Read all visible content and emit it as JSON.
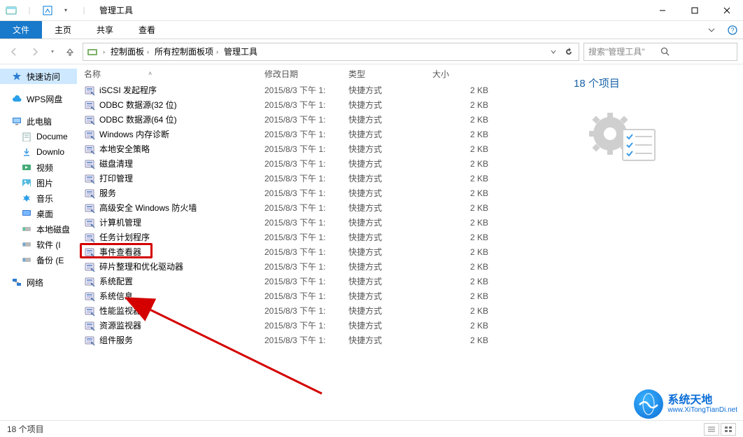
{
  "window": {
    "title": "管理工具",
    "min": "—",
    "max": "□",
    "close": "✕"
  },
  "ribbon": {
    "file": "文件",
    "tabs": [
      "主页",
      "共享",
      "查看"
    ]
  },
  "address": {
    "crumbs": [
      "控制面板",
      "所有控制面板项",
      "管理工具"
    ]
  },
  "search": {
    "placeholder": "搜索\"管理工具\""
  },
  "nav": {
    "quick": "快速访问",
    "wps": "WPS网盘",
    "thispc": "此电脑",
    "thispc_items": [
      "Docume",
      "Downlo",
      "视频",
      "图片",
      "音乐",
      "桌面",
      "本地磁盘",
      "软件 (I",
      "备份 (E"
    ],
    "network": "网络"
  },
  "columns": {
    "name": "名称",
    "date": "修改日期",
    "type": "类型",
    "size": "大小"
  },
  "rows": [
    {
      "name": "iSCSI 发起程序",
      "date": "2015/8/3 下午 1:",
      "type": "快捷方式",
      "size": "2 KB"
    },
    {
      "name": "ODBC 数据源(32 位)",
      "date": "2015/8/3 下午 1:",
      "type": "快捷方式",
      "size": "2 KB"
    },
    {
      "name": "ODBC 数据源(64 位)",
      "date": "2015/8/3 下午 1:",
      "type": "快捷方式",
      "size": "2 KB"
    },
    {
      "name": "Windows 内存诊断",
      "date": "2015/8/3 下午 1:",
      "type": "快捷方式",
      "size": "2 KB"
    },
    {
      "name": "本地安全策略",
      "date": "2015/8/3 下午 1:",
      "type": "快捷方式",
      "size": "2 KB"
    },
    {
      "name": "磁盘清理",
      "date": "2015/8/3 下午 1:",
      "type": "快捷方式",
      "size": "2 KB"
    },
    {
      "name": "打印管理",
      "date": "2015/8/3 下午 1:",
      "type": "快捷方式",
      "size": "2 KB"
    },
    {
      "name": "服务",
      "date": "2015/8/3 下午 1:",
      "type": "快捷方式",
      "size": "2 KB"
    },
    {
      "name": "高级安全 Windows 防火墙",
      "date": "2015/8/3 下午 1:",
      "type": "快捷方式",
      "size": "2 KB"
    },
    {
      "name": "计算机管理",
      "date": "2015/8/3 下午 1:",
      "type": "快捷方式",
      "size": "2 KB"
    },
    {
      "name": "任务计划程序",
      "date": "2015/8/3 下午 1:",
      "type": "快捷方式",
      "size": "2 KB"
    },
    {
      "name": "事件查看器",
      "date": "2015/8/3 下午 1:",
      "type": "快捷方式",
      "size": "2 KB",
      "hl": true
    },
    {
      "name": "碎片整理和优化驱动器",
      "date": "2015/8/3 下午 1:",
      "type": "快捷方式",
      "size": "2 KB"
    },
    {
      "name": "系统配置",
      "date": "2015/8/3 下午 1:",
      "type": "快捷方式",
      "size": "2 KB"
    },
    {
      "name": "系统信息",
      "date": "2015/8/3 下午 1:",
      "type": "快捷方式",
      "size": "2 KB"
    },
    {
      "name": "性能监视器",
      "date": "2015/8/3 下午 1:",
      "type": "快捷方式",
      "size": "2 KB"
    },
    {
      "name": "资源监视器",
      "date": "2015/8/3 下午 1:",
      "type": "快捷方式",
      "size": "2 KB"
    },
    {
      "name": "组件服务",
      "date": "2015/8/3 下午 1:",
      "type": "快捷方式",
      "size": "2 KB"
    }
  ],
  "details": {
    "count": "18 个项目"
  },
  "status": {
    "text": "18 个项目"
  },
  "watermark": {
    "line1": "系统天地",
    "line2": "www.XiTongTianDi.net"
  }
}
